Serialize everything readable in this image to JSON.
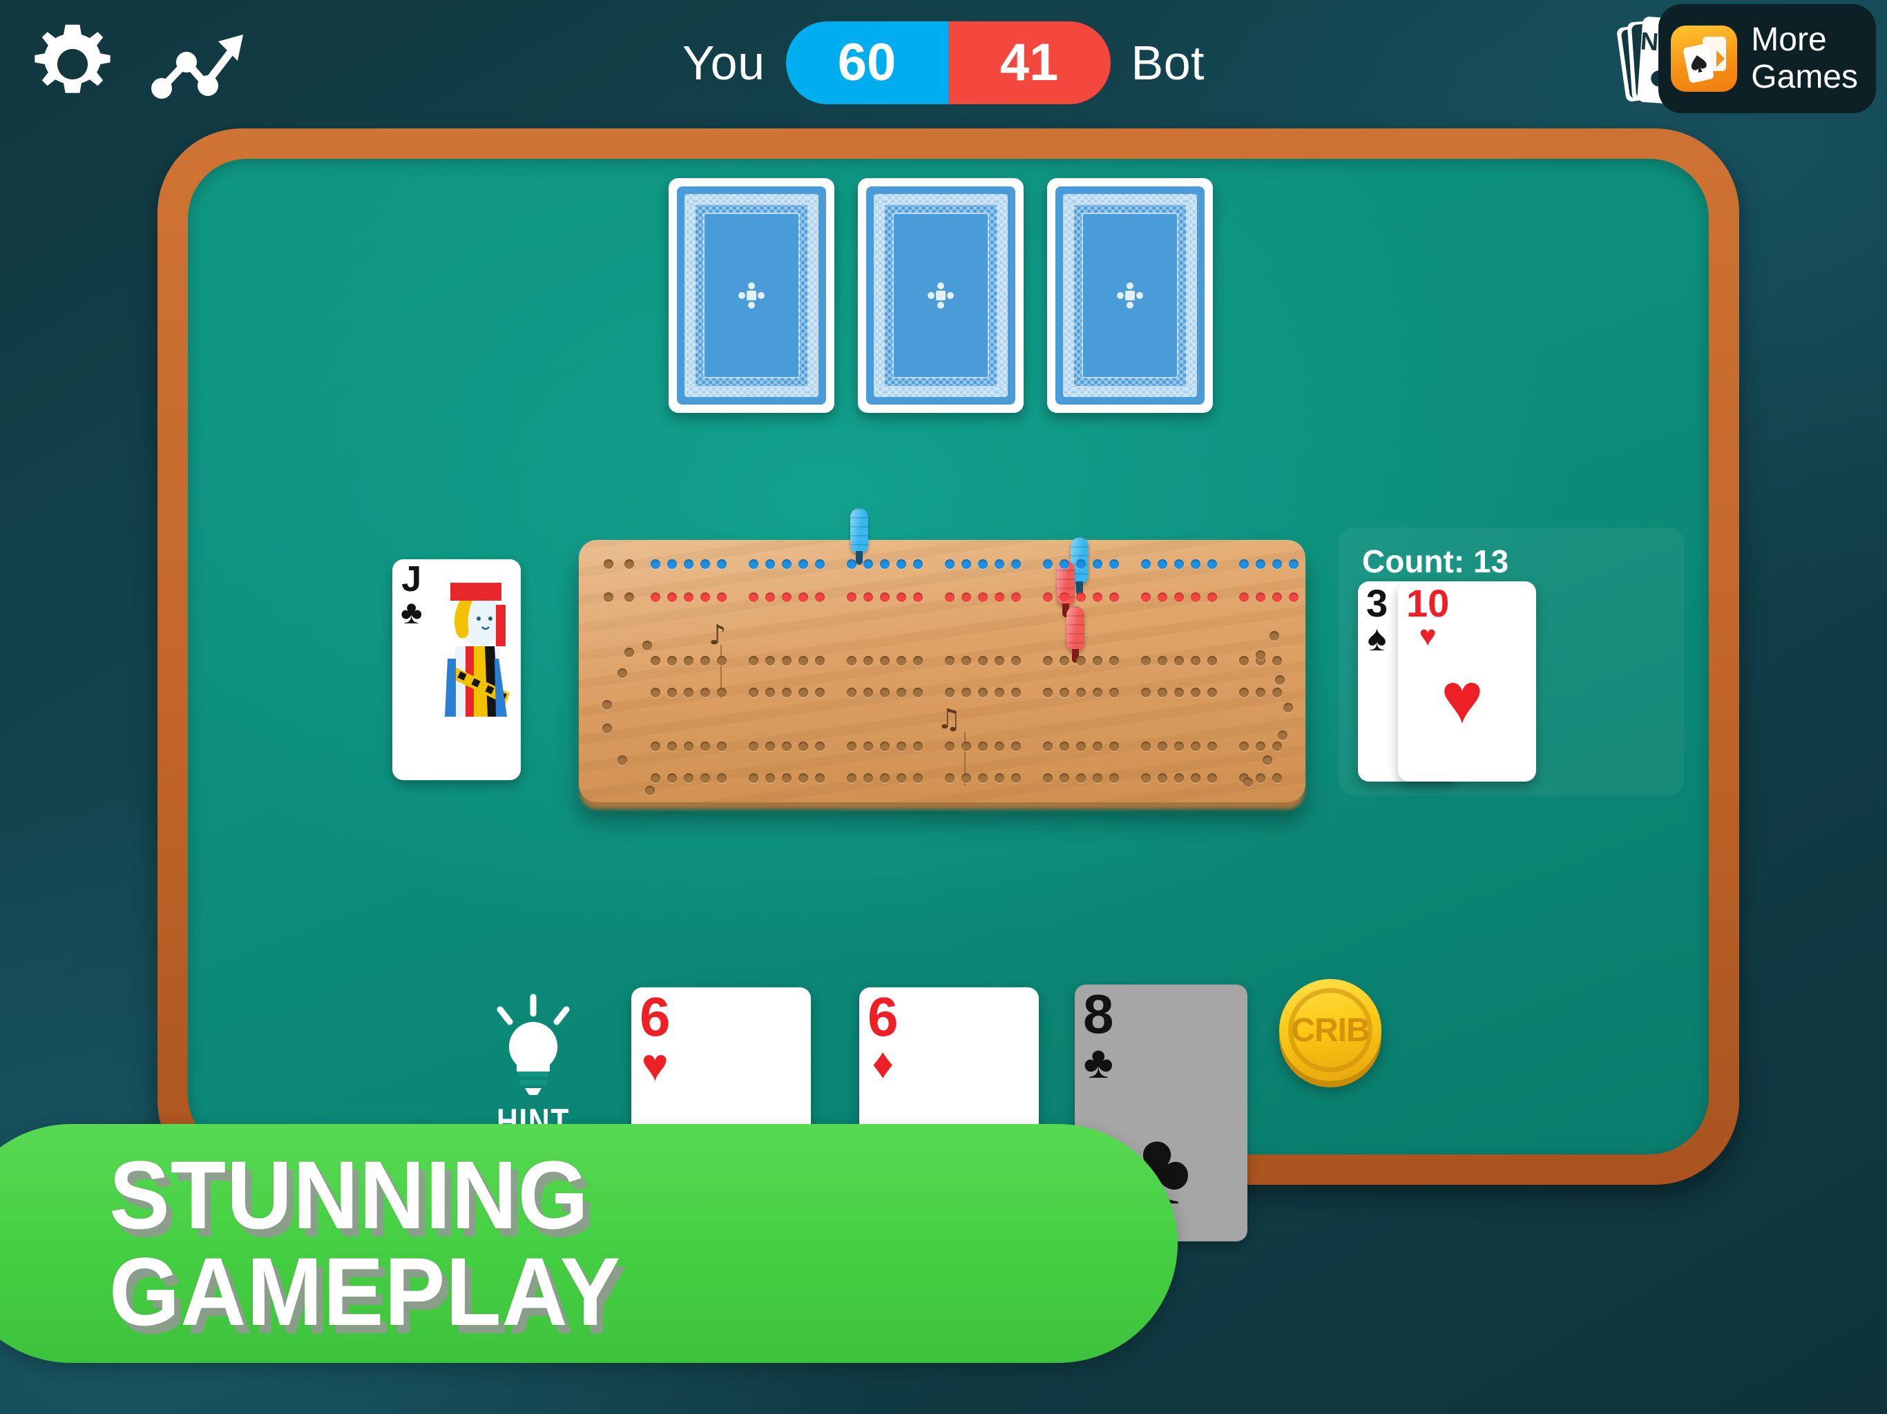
{
  "topbar": {
    "settings_icon": "gear-icon",
    "stats_icon": "trend-up-icon",
    "player_label": "You",
    "player_score": "60",
    "opponent_score": "41",
    "opponent_label": "Bot",
    "player_color": "#00AEEF",
    "opponent_color": "#F4483F",
    "new_badge": "NEW",
    "new_badge_icon": "card-deck-icon",
    "more_games_line1": "More",
    "more_games_line2": "Games",
    "more_games_icon": "cards-app-icon"
  },
  "table": {
    "rail_color": "#C4672B",
    "felt_color": "#0C8A78",
    "background_color": "#12373F"
  },
  "opponent_hand": {
    "label": "bot-face-down-cards",
    "cards": [
      "back",
      "back",
      "back"
    ]
  },
  "starter_card": {
    "rank": "J",
    "suit": "♣",
    "suit_name": "clubs",
    "color": "black"
  },
  "count_panel": {
    "label": "Count: 13",
    "count_value": "13",
    "played_cards": [
      {
        "rank": "3",
        "suit": "♠",
        "suit_name": "spades",
        "color": "black"
      },
      {
        "rank": "10",
        "suit": "♥",
        "suit_name": "hearts",
        "color": "red"
      }
    ]
  },
  "player_hand": {
    "cards": [
      {
        "rank": "6",
        "suit": "♥",
        "suit_name": "hearts",
        "color": "red",
        "state": "playable"
      },
      {
        "rank": "6",
        "suit": "♦",
        "suit_name": "diamonds",
        "color": "red",
        "state": "playable"
      },
      {
        "rank": "8",
        "suit": "♣",
        "suit_name": "clubs",
        "color": "black",
        "state": "disabled"
      }
    ]
  },
  "hint": {
    "label": "HINT",
    "icon": "lightbulb-icon"
  },
  "crib": {
    "label": "CRIB",
    "color": "#FBC714"
  },
  "board": {
    "name": "cribbage-board",
    "player_pegs_color": "#37B7F0",
    "opponent_pegs_color": "#F35B59",
    "filled_blue_holes": 60,
    "filled_red_holes": 41
  },
  "banner": {
    "text": "STUNNING GAMEPLAY",
    "color": "#45CF42"
  }
}
